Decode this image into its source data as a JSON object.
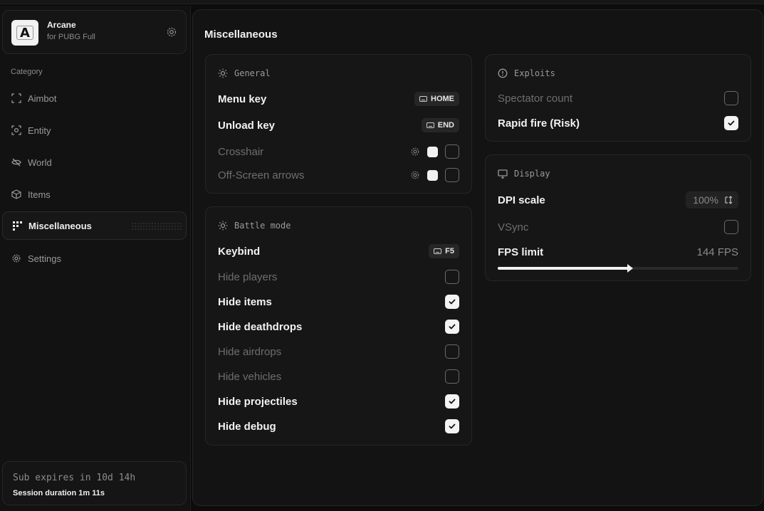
{
  "brand": {
    "name": "Arcane",
    "subtitle": "for PUBG Full",
    "logo_letter": "A",
    "settings_icon": "gear-icon"
  },
  "sidebar": {
    "category_label": "Category",
    "items": [
      {
        "label": "Aimbot",
        "icon": "crosshair-frame-icon",
        "active": false
      },
      {
        "label": "Entity",
        "icon": "scan-face-icon",
        "active": false
      },
      {
        "label": "World",
        "icon": "eye-off-icon",
        "active": false
      },
      {
        "label": "Items",
        "icon": "box-icon",
        "active": false
      },
      {
        "label": "Miscellaneous",
        "icon": "grid-icon",
        "active": true
      },
      {
        "label": "Settings",
        "icon": "gear-icon",
        "active": false
      }
    ]
  },
  "footer": {
    "sub_expires": "Sub expires in 10d 14h",
    "session": "Session duration  1m 11s"
  },
  "main": {
    "title": "Miscellaneous"
  },
  "general": {
    "title": "General",
    "menu_key": {
      "label": "Menu key",
      "key": "HOME"
    },
    "unload_key": {
      "label": "Unload key",
      "key": "END"
    },
    "crosshair": {
      "label": "Crosshair",
      "enabled": false
    },
    "offscreen": {
      "label": "Off-Screen arrows",
      "enabled": false
    }
  },
  "battle": {
    "title": "Battle mode",
    "keybind": {
      "label": "Keybind",
      "key": "F5"
    },
    "options": [
      {
        "label": "Hide players",
        "checked": false
      },
      {
        "label": "Hide items",
        "checked": true
      },
      {
        "label": "Hide deathdrops",
        "checked": true
      },
      {
        "label": "Hide airdrops",
        "checked": false
      },
      {
        "label": "Hide vehicles",
        "checked": false
      },
      {
        "label": "Hide projectiles",
        "checked": true
      },
      {
        "label": "Hide debug",
        "checked": true
      }
    ]
  },
  "exploits": {
    "title": "Exploits",
    "options": [
      {
        "label": "Spectator count",
        "checked": false
      },
      {
        "label": "Rapid fire (Risk)",
        "checked": true
      }
    ]
  },
  "display": {
    "title": "Display",
    "dpi": {
      "label": "DPI scale",
      "value": "100%"
    },
    "vsync": {
      "label": "VSync",
      "checked": false
    },
    "fps": {
      "label": "FPS limit",
      "value_text": "144 FPS",
      "fill_fraction": 0.55
    }
  },
  "colors": {
    "background": "#0c0c0c",
    "panel": "#131313",
    "card": "#161616",
    "accent": "#f1f1f1"
  }
}
